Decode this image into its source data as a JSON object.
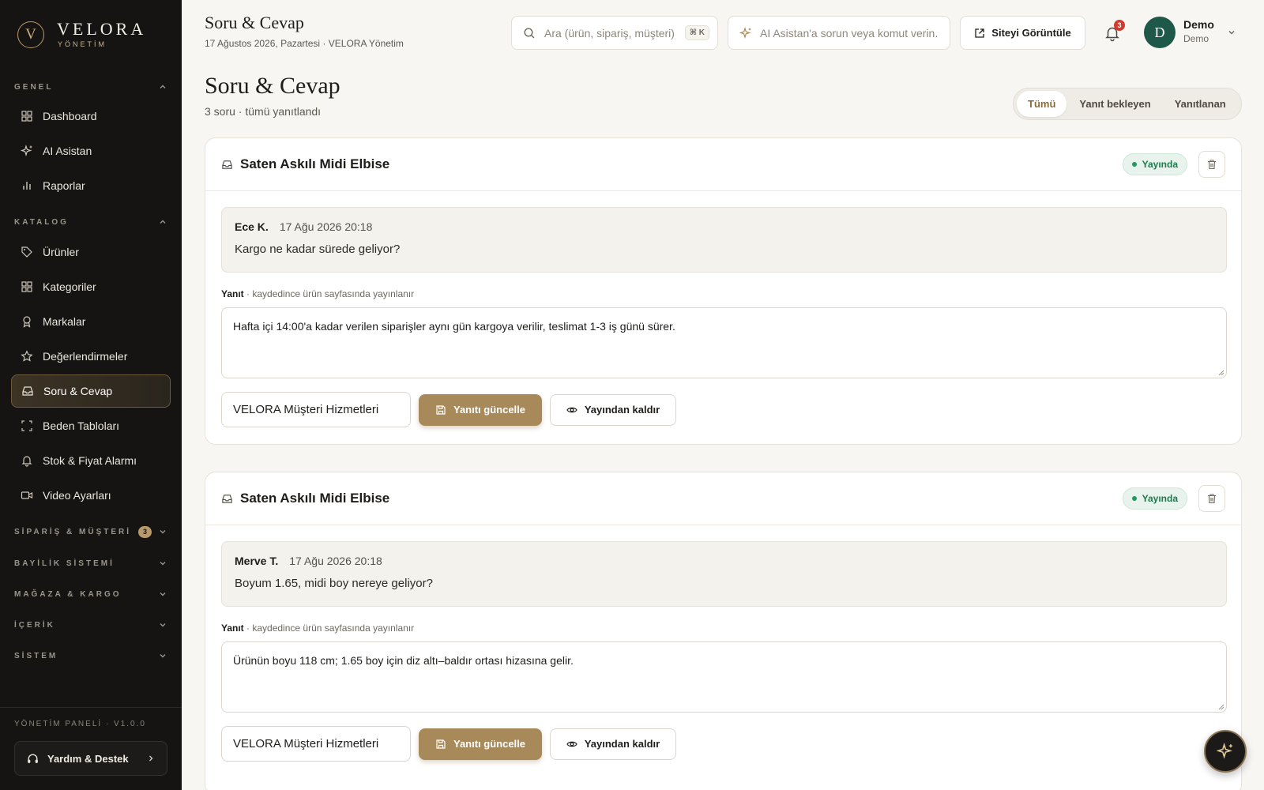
{
  "brand": {
    "mark": "V",
    "name": "VELORA",
    "sub": "YÖNETİM"
  },
  "sidebar": {
    "sections": {
      "genel": "GENEL",
      "katalog": "KATALOG",
      "siparis": "SİPARİŞ & MÜŞTERİ",
      "siparis_badge": "3",
      "bayilik": "BAYİLİK SİSTEMİ",
      "magaza": "MAĞAZA & KARGO",
      "icerik": "İÇERİK",
      "sistem": "SİSTEM"
    },
    "genel_items": [
      {
        "label": "Dashboard",
        "icon": "grid-icon"
      },
      {
        "label": "AI Asistan",
        "icon": "sparkle-icon"
      },
      {
        "label": "Raporlar",
        "icon": "bar-chart-icon"
      }
    ],
    "katalog_items": [
      {
        "label": "Ürünler",
        "icon": "tag-icon"
      },
      {
        "label": "Kategoriler",
        "icon": "grid-icon"
      },
      {
        "label": "Markalar",
        "icon": "award-icon"
      },
      {
        "label": "Değerlendirmeler",
        "icon": "star-icon"
      },
      {
        "label": "Soru & Cevap",
        "icon": "inbox-icon",
        "active": true
      },
      {
        "label": "Beden Tabloları",
        "icon": "scan-icon"
      },
      {
        "label": "Stok & Fiyat Alarmı",
        "icon": "bell-icon"
      },
      {
        "label": "Video Ayarları",
        "icon": "video-icon"
      }
    ],
    "version": "YÖNETİM PANELİ · V1.0.0",
    "help": "Yardım & Destek"
  },
  "header": {
    "title": "Soru & Cevap",
    "subtitle": "17 Ağustos 2026, Pazartesi · VELORA Yönetim",
    "search_placeholder": "Ara (ürün, sipariş, müşteri)",
    "search_shortcut": "⌘ K",
    "ai_placeholder": "AI Asistan'a sorun veya komut verin.",
    "site_button": "Siteyi Görüntüle",
    "notifications": "3",
    "user_initial": "D",
    "user_name": "Demo",
    "user_role": "Demo"
  },
  "page": {
    "title": "Soru & Cevap",
    "subtitle": "3 soru · tümü yanıtlandı",
    "filters": [
      "Tümü",
      "Yanıt bekleyen",
      "Yanıtlanan"
    ],
    "active_filter": "Tümü"
  },
  "questions": [
    {
      "product": "Saten Askılı Midi Elbise",
      "status": "Yayında",
      "author": "Ece K.",
      "date": "17 Ağu 2026 20:18",
      "question": "Kargo ne kadar sürede geliyor?",
      "answer_label": "Yanıt",
      "answer_hint": " · kaydedince ürün sayfasında yayınlanır",
      "answer": "Hafta içi 14:00'a kadar verilen siparişler aynı gün kargoya verilir, teslimat 1-3 iş günü sürer.",
      "signature": "VELORA Müşteri Hizmetleri",
      "update_button": "Yanıtı güncelle",
      "unpublish_button": "Yayından kaldır"
    },
    {
      "product": "Saten Askılı Midi Elbise",
      "status": "Yayında",
      "author": "Merve T.",
      "date": "17 Ağu 2026 20:18",
      "question": "Boyum 1.65, midi boy nereye geliyor?",
      "answer_label": "Yanıt",
      "answer_hint": " · kaydedince ürün sayfasında yayınlanır",
      "answer": "Ürünün boyu 118 cm; 1.65 boy için diz altı–baldır ortası hizasına gelir.",
      "signature": "VELORA Müşteri Hizmetleri",
      "update_button": "Yanıtı güncelle",
      "unpublish_button": "Yayından kaldır"
    }
  ],
  "colors": {
    "accent": "#a88a5a",
    "sidebar": "#151413",
    "success": "#1f7a4d"
  }
}
